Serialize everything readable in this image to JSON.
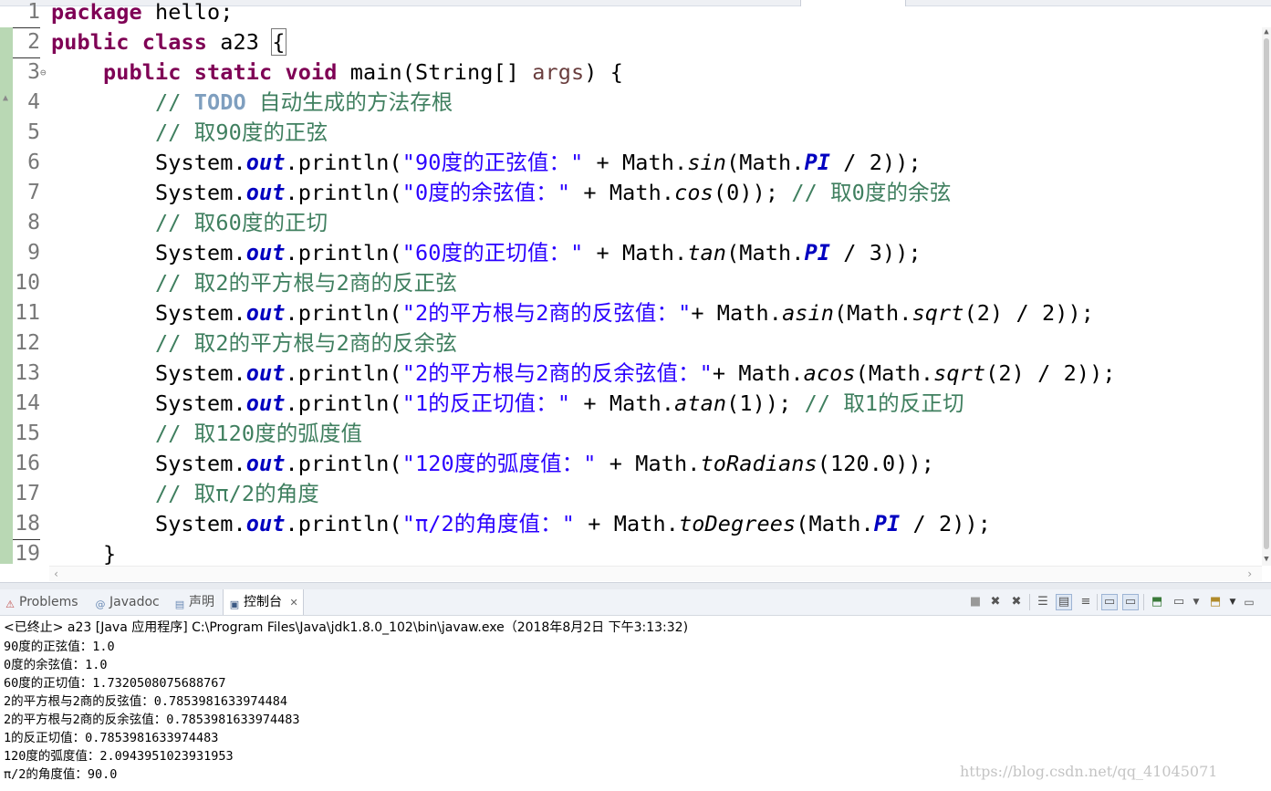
{
  "editor": {
    "lines": [
      {
        "n": "1",
        "segs": [
          {
            "c": "kw",
            "t": "package"
          },
          {
            "c": "",
            "t": " hello;"
          }
        ]
      },
      {
        "n": "2",
        "segs": [
          {
            "c": "kw",
            "t": "public"
          },
          {
            "c": "",
            "t": " "
          },
          {
            "c": "kw",
            "t": "class"
          },
          {
            "c": "",
            "t": " a23 "
          },
          {
            "c": "brace",
            "t": "{"
          }
        ]
      },
      {
        "n": "3",
        "fold": "⊖",
        "segs": [
          {
            "c": "",
            "t": "    "
          },
          {
            "c": "kw",
            "t": "public"
          },
          {
            "c": "",
            "t": " "
          },
          {
            "c": "kw",
            "t": "static"
          },
          {
            "c": "",
            "t": " "
          },
          {
            "c": "kw",
            "t": "void"
          },
          {
            "c": "",
            "t": " main(String[] "
          },
          {
            "c": "param",
            "t": "args"
          },
          {
            "c": "",
            "t": ") {"
          }
        ]
      },
      {
        "n": "4",
        "segs": [
          {
            "c": "",
            "t": "        "
          },
          {
            "c": "cm",
            "t": "// "
          },
          {
            "c": "todo",
            "t": "TODO"
          },
          {
            "c": "cm",
            "t": " 自动生成的方法存根"
          }
        ]
      },
      {
        "n": "5",
        "segs": [
          {
            "c": "",
            "t": "        "
          },
          {
            "c": "cm",
            "t": "// 取90度的正弦"
          }
        ]
      },
      {
        "n": "6",
        "segs": [
          {
            "c": "",
            "t": "        System."
          },
          {
            "c": "fld",
            "t": "out"
          },
          {
            "c": "",
            "t": ".println("
          },
          {
            "c": "st",
            "t": "\"90度的正弦值：\""
          },
          {
            "c": "",
            "t": " + Math."
          },
          {
            "c": "it",
            "t": "sin"
          },
          {
            "c": "",
            "t": "(Math."
          },
          {
            "c": "fld",
            "t": "PI"
          },
          {
            "c": "",
            "t": " / 2));"
          }
        ]
      },
      {
        "n": "7",
        "segs": [
          {
            "c": "",
            "t": "        System."
          },
          {
            "c": "fld",
            "t": "out"
          },
          {
            "c": "",
            "t": ".println("
          },
          {
            "c": "st",
            "t": "\"0度的余弦值：\""
          },
          {
            "c": "",
            "t": " + Math."
          },
          {
            "c": "it",
            "t": "cos"
          },
          {
            "c": "",
            "t": "(0)); "
          },
          {
            "c": "cm",
            "t": "// 取0度的余弦"
          }
        ]
      },
      {
        "n": "8",
        "segs": [
          {
            "c": "",
            "t": "        "
          },
          {
            "c": "cm",
            "t": "// 取60度的正切"
          }
        ]
      },
      {
        "n": "9",
        "segs": [
          {
            "c": "",
            "t": "        System."
          },
          {
            "c": "fld",
            "t": "out"
          },
          {
            "c": "",
            "t": ".println("
          },
          {
            "c": "st",
            "t": "\"60度的正切值：\""
          },
          {
            "c": "",
            "t": " + Math."
          },
          {
            "c": "it",
            "t": "tan"
          },
          {
            "c": "",
            "t": "(Math."
          },
          {
            "c": "fld",
            "t": "PI"
          },
          {
            "c": "",
            "t": " / 3));"
          }
        ]
      },
      {
        "n": "10",
        "segs": [
          {
            "c": "",
            "t": "        "
          },
          {
            "c": "cm",
            "t": "// 取2的平方根与2商的反正弦"
          }
        ]
      },
      {
        "n": "11",
        "segs": [
          {
            "c": "",
            "t": "        System."
          },
          {
            "c": "fld",
            "t": "out"
          },
          {
            "c": "",
            "t": ".println("
          },
          {
            "c": "st",
            "t": "\"2的平方根与2商的反弦值：\""
          },
          {
            "c": "",
            "t": "+ Math."
          },
          {
            "c": "it",
            "t": "asin"
          },
          {
            "c": "",
            "t": "(Math."
          },
          {
            "c": "it",
            "t": "sqrt"
          },
          {
            "c": "",
            "t": "(2) / 2));"
          }
        ]
      },
      {
        "n": "12",
        "segs": [
          {
            "c": "",
            "t": "        "
          },
          {
            "c": "cm",
            "t": "// 取2的平方根与2商的反余弦"
          }
        ]
      },
      {
        "n": "13",
        "segs": [
          {
            "c": "",
            "t": "        System."
          },
          {
            "c": "fld",
            "t": "out"
          },
          {
            "c": "",
            "t": ".println("
          },
          {
            "c": "st",
            "t": "\"2的平方根与2商的反余弦值：\""
          },
          {
            "c": "",
            "t": "+ Math."
          },
          {
            "c": "it",
            "t": "acos"
          },
          {
            "c": "",
            "t": "(Math."
          },
          {
            "c": "it",
            "t": "sqrt"
          },
          {
            "c": "",
            "t": "(2) / 2));"
          }
        ]
      },
      {
        "n": "14",
        "segs": [
          {
            "c": "",
            "t": "        System."
          },
          {
            "c": "fld",
            "t": "out"
          },
          {
            "c": "",
            "t": ".println("
          },
          {
            "c": "st",
            "t": "\"1的反正切值：\""
          },
          {
            "c": "",
            "t": " + Math."
          },
          {
            "c": "it",
            "t": "atan"
          },
          {
            "c": "",
            "t": "(1)); "
          },
          {
            "c": "cm",
            "t": "// 取1的反正切"
          }
        ]
      },
      {
        "n": "15",
        "segs": [
          {
            "c": "",
            "t": "        "
          },
          {
            "c": "cm",
            "t": "// 取120度的弧度值"
          }
        ]
      },
      {
        "n": "16",
        "segs": [
          {
            "c": "",
            "t": "        System."
          },
          {
            "c": "fld",
            "t": "out"
          },
          {
            "c": "",
            "t": ".println("
          },
          {
            "c": "st",
            "t": "\"120度的弧度值：\""
          },
          {
            "c": "",
            "t": " + Math."
          },
          {
            "c": "it",
            "t": "toRadians"
          },
          {
            "c": "",
            "t": "(120.0));"
          }
        ]
      },
      {
        "n": "17",
        "segs": [
          {
            "c": "",
            "t": "        "
          },
          {
            "c": "cm",
            "t": "// 取π/2的角度"
          }
        ]
      },
      {
        "n": "18",
        "segs": [
          {
            "c": "",
            "t": "        System."
          },
          {
            "c": "fld",
            "t": "out"
          },
          {
            "c": "",
            "t": ".println("
          },
          {
            "c": "st",
            "t": "\"π/2的角度值：\""
          },
          {
            "c": "",
            "t": " + Math."
          },
          {
            "c": "it",
            "t": "toDegrees"
          },
          {
            "c": "",
            "t": "(Math."
          },
          {
            "c": "fld",
            "t": "PI"
          },
          {
            "c": "",
            "t": " / 2));"
          }
        ]
      },
      {
        "n": "19",
        "segs": [
          {
            "c": "",
            "t": "    }"
          }
        ]
      }
    ]
  },
  "views": {
    "tabs": [
      {
        "icon": "⚠",
        "label": "Problems"
      },
      {
        "icon": "@",
        "label": "Javadoc"
      },
      {
        "icon": "▤",
        "label": "声明"
      },
      {
        "icon": "▣",
        "label": "控制台",
        "close": "✕"
      }
    ]
  },
  "console": {
    "status": "<已终止> a23 [Java 应用程序] C:\\Program Files\\Java\\jdk1.8.0_102\\bin\\javaw.exe（2018年8月2日 下午3:13:32)",
    "output": [
      "90度的正弦值：1.0",
      "0度的余弦值：1.0",
      "60度的正切值：1.7320508075688767",
      "2的平方根与2商的反弦值：0.7853981633974484",
      "2的平方根与2商的反余弦值：0.7853981633974483",
      "1的反正切值：0.7853981633974483",
      "120度的弧度值：2.0943951023931953",
      "π/2的角度值：90.0"
    ]
  },
  "watermark": "https://blog.csdn.net/qq_41045071",
  "colors": {
    "keyword": "#7f0055",
    "comment": "#3f7f5f",
    "string": "#2a00ff",
    "field": "#0000c0",
    "todo": "#7f9fbf"
  }
}
